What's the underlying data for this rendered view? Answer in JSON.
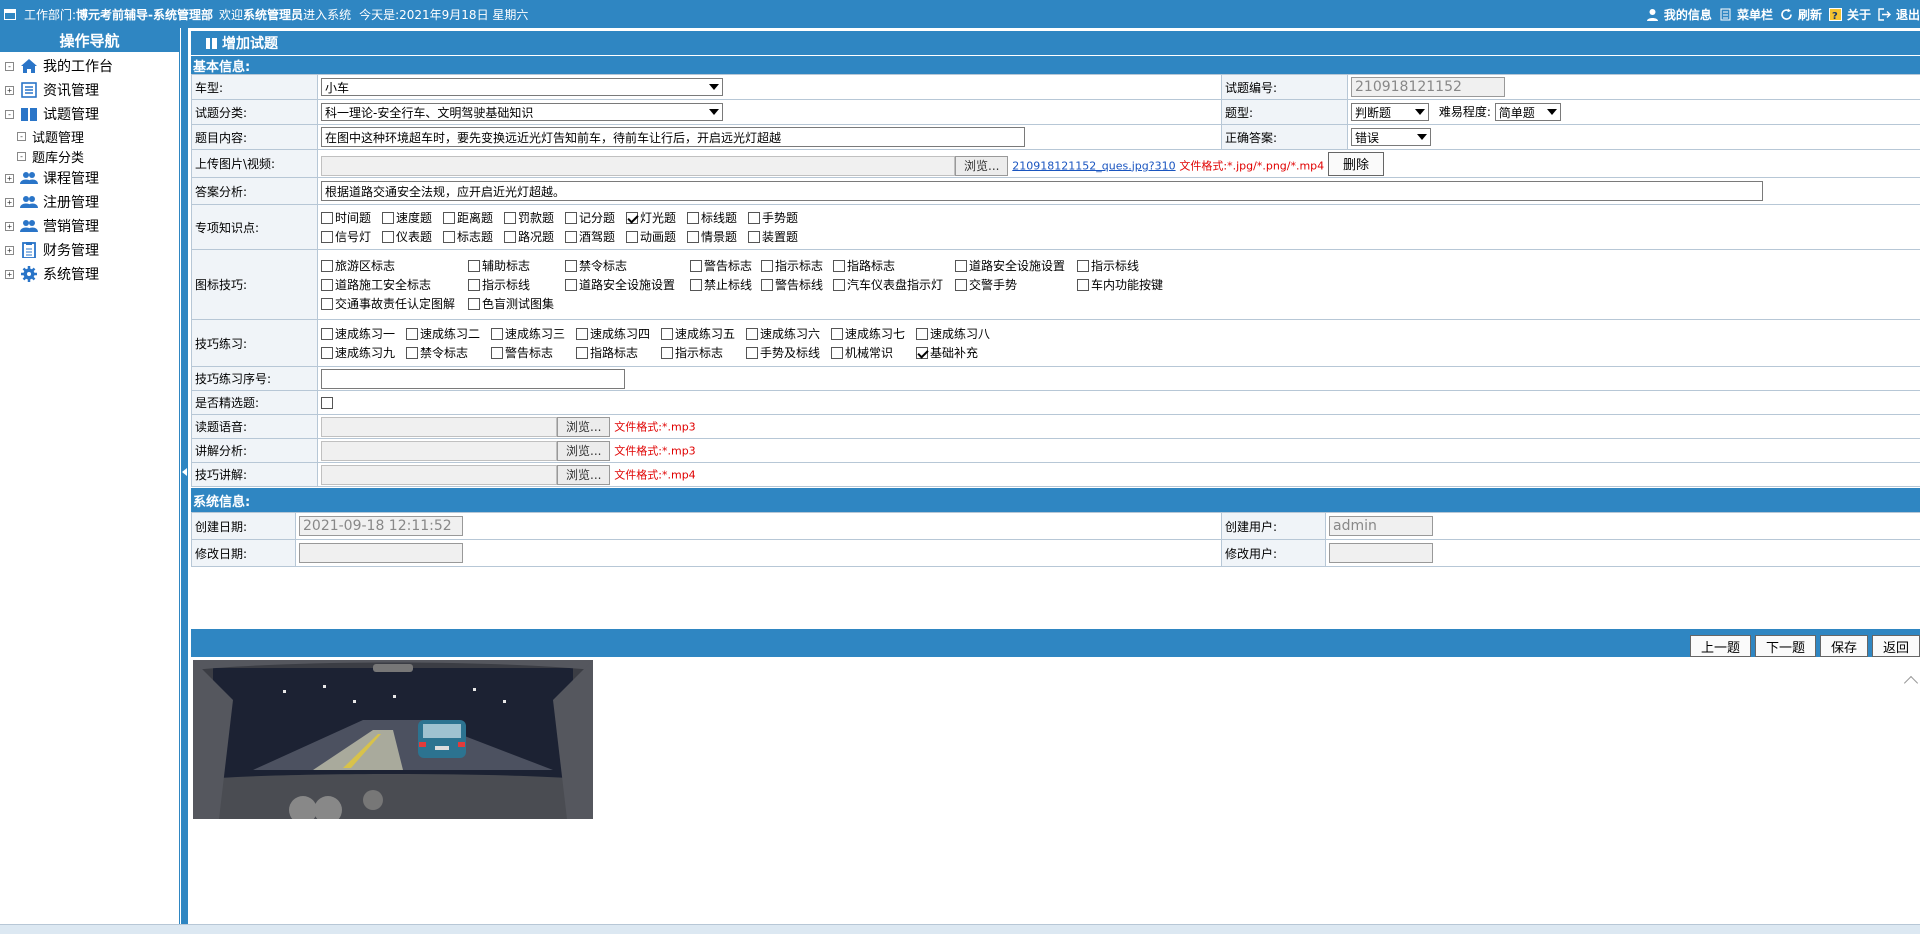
{
  "topbar": {
    "dept_prefix": "工作部门:",
    "dept_name": "博元考前辅导-系统管理部",
    "welcome_prefix": "欢迎",
    "welcome_user": "系统管理员",
    "welcome_suffix": "进入系统",
    "today": "今天是:2021年9月18日 星期六",
    "links": [
      "我的信息",
      "菜单栏",
      "刷新",
      "关于",
      "退出"
    ]
  },
  "sidebar": {
    "header": "操作导航",
    "items": [
      {
        "label": "我的工作台",
        "toggle": "-"
      },
      {
        "label": "资讯管理",
        "toggle": "+"
      },
      {
        "label": "试题管理",
        "toggle": "-"
      },
      {
        "label": "试题管理",
        "toggle": "-"
      },
      {
        "label": "题库分类",
        "toggle": "-"
      },
      {
        "label": "课程管理",
        "toggle": "+"
      },
      {
        "label": "注册管理",
        "toggle": "+"
      },
      {
        "label": "营销管理",
        "toggle": "+"
      },
      {
        "label": "财务管理",
        "toggle": "+"
      },
      {
        "label": "系统管理",
        "toggle": "+"
      }
    ]
  },
  "page": {
    "title": "增加试题",
    "basic_info": "基本信息:",
    "system_info": "系统信息:"
  },
  "form": {
    "car_type": {
      "label": "车型:",
      "value": "小车"
    },
    "question_no": {
      "label": "试题编号:",
      "value": "210918121152"
    },
    "category": {
      "label": "试题分类:",
      "value": "科一理论-安全行车、文明驾驶基础知识"
    },
    "qtype": {
      "label": "题型:",
      "value": "判断题"
    },
    "difficulty": {
      "label": "难易程度:",
      "value": "简单题"
    },
    "content": {
      "label": "题目内容:",
      "value": "在图中这种环境超车时，要先变换远近光灯告知前车，待前车让行后，开启远光灯超越"
    },
    "answer": {
      "label": "正确答案:",
      "value": "错误"
    },
    "upload": {
      "label": "上传图片\\视频:",
      "browse": "浏览...",
      "file_link": "210918121152_ques.jpg?310",
      "format": "文件格式:*.jpg/*.png/*.mp4",
      "delete": "删除"
    },
    "analysis": {
      "label": "答案分析:",
      "value": "根据道路交通安全法规，应开启近光灯超越。"
    },
    "knowledge": {
      "label": "专项知识点:",
      "row1": [
        [
          "时间题",
          false
        ],
        [
          "速度题",
          false
        ],
        [
          "距离题",
          false
        ],
        [
          "罚款题",
          false
        ],
        [
          "记分题",
          false
        ],
        [
          "灯光题",
          true
        ],
        [
          "标线题",
          false
        ],
        [
          "手势题",
          false
        ]
      ],
      "row2": [
        [
          "信号灯",
          false
        ],
        [
          "仪表题",
          false
        ],
        [
          "标志题",
          false
        ],
        [
          "路况题",
          false
        ],
        [
          "酒驾题",
          false
        ],
        [
          "动画题",
          false
        ],
        [
          "情景题",
          false
        ],
        [
          "装置题",
          false
        ]
      ]
    },
    "icon_skill": {
      "label": "图标技巧:",
      "row1": [
        [
          "旅游区标志",
          false
        ],
        [
          "辅助标志",
          false
        ],
        [
          "禁令标志",
          false
        ],
        [
          "警告标志",
          false
        ],
        [
          "指示标志",
          false
        ],
        [
          "指路标志",
          false
        ],
        [
          "道路安全设施设置",
          false
        ],
        [
          "指示标线",
          false
        ]
      ],
      "row2": [
        [
          "道路施工安全标志",
          false
        ],
        [
          "指示标线",
          false
        ],
        [
          "道路安全设施设置",
          false
        ],
        [
          "禁止标线",
          false
        ],
        [
          "警告标线",
          false
        ],
        [
          "汽车仪表盘指示灯",
          false
        ],
        [
          "交警手势",
          false
        ],
        [
          "车内功能按键",
          false
        ]
      ],
      "row3": [
        [
          "交通事故责任认定图解",
          false
        ],
        [
          "色盲测试图集",
          false
        ]
      ]
    },
    "practice": {
      "label": "技巧练习:",
      "row1": [
        [
          "速成练习一",
          false
        ],
        [
          "速成练习二",
          false
        ],
        [
          "速成练习三",
          false
        ],
        [
          "速成练习四",
          false
        ],
        [
          "速成练习五",
          false
        ],
        [
          "速成练习六",
          false
        ],
        [
          "速成练习七",
          false
        ],
        [
          "速成练习八",
          false
        ]
      ],
      "row2": [
        [
          "速成练习九",
          false
        ],
        [
          "禁令标志",
          false
        ],
        [
          "警告标志",
          false
        ],
        [
          "指路标志",
          false
        ],
        [
          "指示标志",
          false
        ],
        [
          "手势及标线",
          false
        ],
        [
          "机械常识",
          false
        ],
        [
          "基础补充",
          true
        ]
      ]
    },
    "practice_no": {
      "label": "技巧练习序号:",
      "value": ""
    },
    "featured": {
      "label": "是否精选题:"
    },
    "voice": {
      "label": "读题语音:",
      "browse": "浏览...",
      "format": "文件格式:*.mp3"
    },
    "explain": {
      "label": "讲解分析:",
      "browse": "浏览...",
      "format": "文件格式:*.mp3"
    },
    "skill_video": {
      "label": "技巧讲解:",
      "browse": "浏览...",
      "format": "文件格式:*.mp4"
    }
  },
  "system": {
    "created_label": "创建日期:",
    "created_value": "2021-09-18 12:11:52",
    "creator_label": "创建用户:",
    "creator_value": "admin",
    "modified_label": "修改日期:",
    "modified_value": "",
    "modifier_label": "修改用户:",
    "modifier_value": ""
  },
  "actions": [
    "上一题",
    "下一题",
    "保存",
    "返回"
  ],
  "colors": {
    "header_blue": "#2f86c2",
    "label_bg": "#f0f4f8",
    "red_text": "#e00000"
  }
}
